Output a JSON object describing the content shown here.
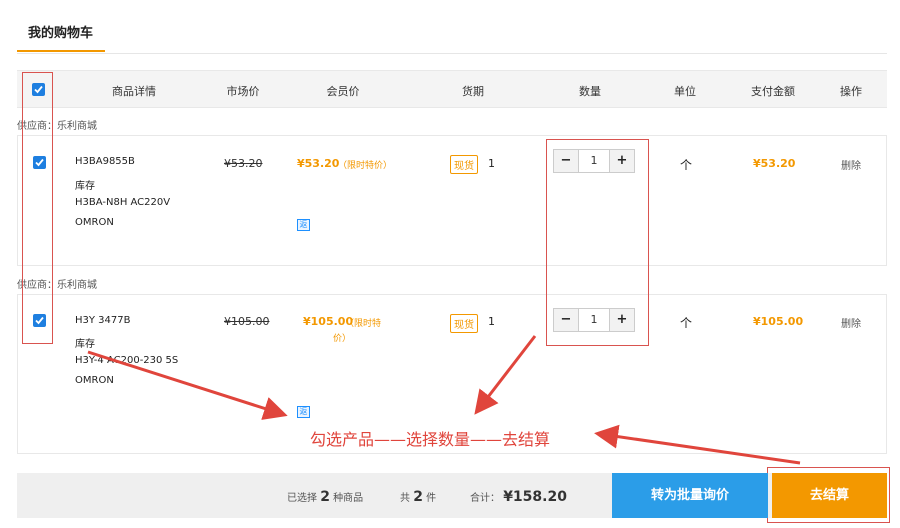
{
  "page": {
    "title": "我的购物车"
  },
  "header": {
    "columns": [
      "商品详情",
      "市场价",
      "会员价",
      "货期",
      "数量",
      "单位",
      "支付金额",
      "操作"
    ]
  },
  "items": [
    {
      "supplier": "供应商：乐利商城",
      "model": "H3BA9855B",
      "stock": "库存",
      "spec": "H3BA-N8H AC220V",
      "brand": "OMRON",
      "market_price": "¥53.20",
      "member_price": "¥53.20",
      "promo": "（限时特价）",
      "lead_tag": "现货",
      "lead_qty": "1",
      "quantity": "1",
      "unit": "个",
      "amount": "¥53.20",
      "action": "删除",
      "fan": "返"
    },
    {
      "supplier": "供应商：乐利商城",
      "model": "H3Y 3477B",
      "stock": "库存",
      "spec": "H3Y-4 AC200-230 5S",
      "brand": "OMRON",
      "market_price": "¥105.00",
      "member_price": "¥105.00",
      "promo_line1": "（限时特",
      "promo_line2": "价）",
      "lead_tag": "现货",
      "lead_qty": "1",
      "quantity": "1",
      "unit": "个",
      "amount": "¥105.00",
      "action": "删除",
      "fan": "返"
    }
  ],
  "stepper": {
    "minus": "−",
    "plus": "+"
  },
  "annotation": "勾选产品——选择数量——去结算",
  "footer": {
    "selected_prefix": "已选择",
    "selected_count": "2",
    "selected_suffix": "种商品",
    "total_prefix": "共",
    "total_count": "2",
    "total_suffix": "件",
    "sum_label": "合计：",
    "sum_value": "¥158.20",
    "inquiry_button": "转为批量询价",
    "checkout_button": "去结算"
  },
  "colors": {
    "accent": "#f39800",
    "blue": "#2b9de8",
    "annotation": "#e0453c"
  }
}
